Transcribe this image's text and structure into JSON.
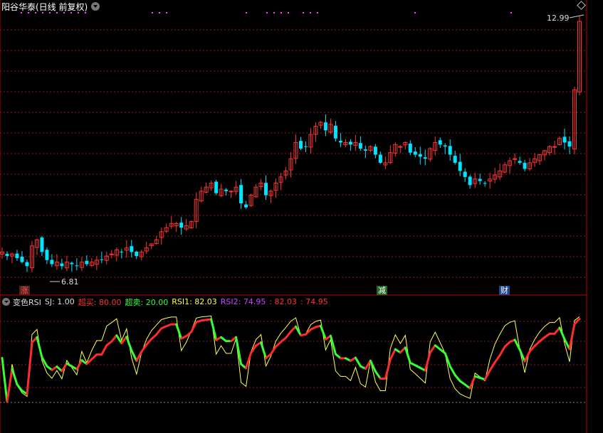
{
  "colors": {
    "up": "#ff3232",
    "down": "#00e5ff",
    "grid": "#8b1a1a",
    "marker_dots": "#ff40ff",
    "axis_line": "#c00000",
    "rsi_line_up": "#ff2a2a",
    "rsi_line_down": "#33ff33",
    "rsi1": "#ffff55",
    "rsi2": "#cc44ff"
  },
  "header": {
    "stock_name": "阳谷华泰(日线 前复权)",
    "dropdown_icon": "chevron-down-icon",
    "settings_icon": "diamond-icon"
  },
  "price_labels": {
    "high": "12.99",
    "low": "6.81"
  },
  "markers": [
    {
      "text": "涨",
      "color": "#ff5050",
      "bg": "#552222"
    },
    {
      "text": "减",
      "color": "#ffffff",
      "bg": "#226622"
    },
    {
      "text": "财",
      "color": "#ffffff",
      "bg": "#224488"
    }
  ],
  "indicator": {
    "name": "变色RSI",
    "sj": "SJ: 1.00",
    "overbought": "超买: 80.00",
    "oversold": "超卖: 20.00",
    "rsi1": "RSI1: 82.03",
    "rsi2": "RSI2: 74.95",
    "extra1": ": 82.03",
    "extra2": ": 74.95"
  },
  "chart_data": {
    "type": "candlestick",
    "title": "阳谷华泰(日线 前复权)",
    "price_range": [
      6.5,
      13.2
    ],
    "highest_price_label": 12.99,
    "lowest_price_label": 6.81,
    "close": [
      7.3,
      7.2,
      7.25,
      7.15,
      7.05,
      6.95,
      7.45,
      7.6,
      7.3,
      7.1,
      7.0,
      7.05,
      6.95,
      7.05,
      7.0,
      6.95,
      7.05,
      7.0,
      7.05,
      7.1,
      7.1,
      7.2,
      7.25,
      7.35,
      7.3,
      7.4,
      7.3,
      7.2,
      7.3,
      7.4,
      7.5,
      7.6,
      7.8,
      7.9,
      8.0,
      8.0,
      7.9,
      7.95,
      8.05,
      8.6,
      8.8,
      8.9,
      9.0,
      8.75,
      8.85,
      8.8,
      8.8,
      8.9,
      8.5,
      8.4,
      8.7,
      8.9,
      9.0,
      8.7,
      8.8,
      9.0,
      9.15,
      9.3,
      9.6,
      10.0,
      9.85,
      9.9,
      10.2,
      10.4,
      10.5,
      10.3,
      10.45,
      10.1,
      10.0,
      10.0,
      9.95,
      10.0,
      9.85,
      9.8,
      9.9,
      9.7,
      9.5,
      9.5,
      9.75,
      9.95,
      9.9,
      10.0,
      9.75,
      9.7,
      9.65,
      9.6,
      9.85,
      10.0,
      9.95,
      9.9,
      9.7,
      9.5,
      9.3,
      9.15,
      8.95,
      9.1,
      9.05,
      9.0,
      9.1,
      9.2,
      9.3,
      9.45,
      9.55,
      9.6,
      9.5,
      9.35,
      9.5,
      9.6,
      9.7,
      9.8,
      9.9,
      9.9,
      10.1,
      10.0,
      9.9,
      11.3,
      12.99
    ]
  }
}
